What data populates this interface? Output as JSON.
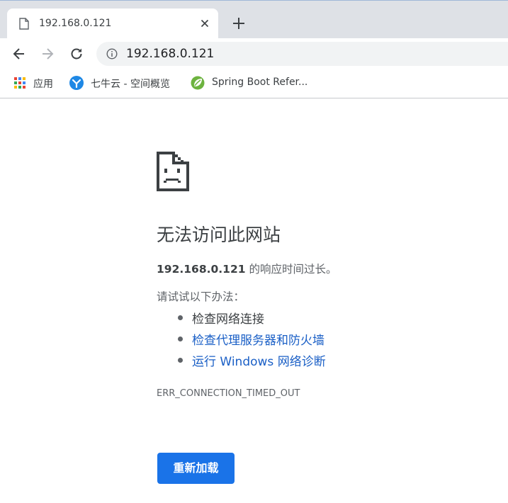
{
  "tab": {
    "title": "192.168.0.121",
    "favicon": "page-icon"
  },
  "toolbar": {
    "url": "192.168.0.121"
  },
  "bookmarks": [
    {
      "label": "应用",
      "icon": "apps-grid-icon"
    },
    {
      "label": "七牛云 - 空间概览",
      "icon": "qiniu-icon"
    },
    {
      "label": "Spring Boot Refer...",
      "icon": "spring-icon"
    }
  ],
  "error": {
    "heading": "无法访问此网站",
    "host": "192.168.0.121",
    "summary_suffix": " 的响应时间过长。",
    "suggestions_title": "请试试以下办法：",
    "suggestions": [
      {
        "text": "检查网络连接",
        "is_link": false
      },
      {
        "text": "检查代理服务器和防火墙",
        "is_link": true
      },
      {
        "text": "运行 Windows 网络诊断",
        "is_link": true
      }
    ],
    "code": "ERR_CONNECTION_TIMED_OUT",
    "reload_label": "重新加载"
  },
  "colors": {
    "accent": "#1a73e8",
    "link": "#1a5fc6",
    "tabstrip": "#dee1e6",
    "omnibox": "#f1f3f4"
  }
}
